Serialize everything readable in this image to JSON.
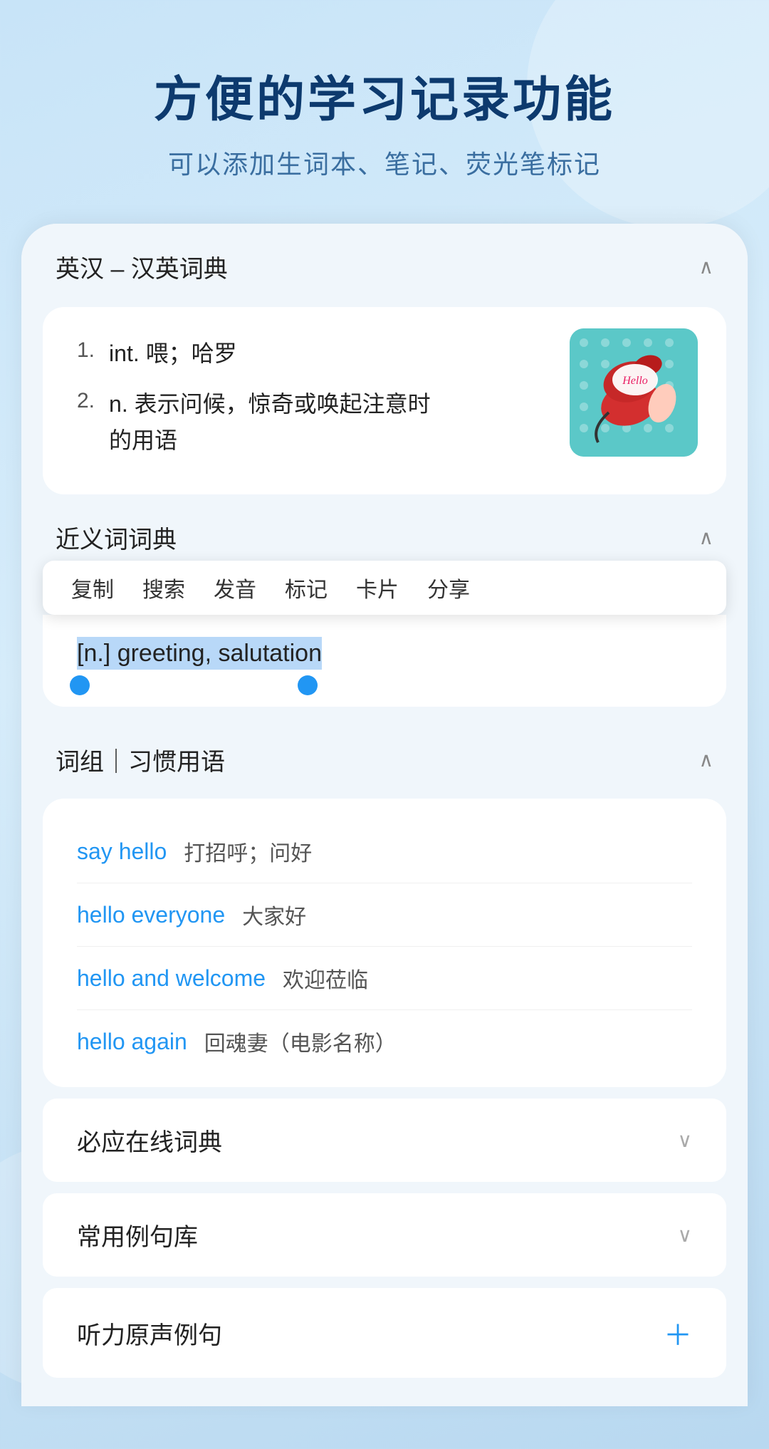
{
  "header": {
    "title": "方便的学习记录功能",
    "subtitle": "可以添加生词本、笔记、荧光笔标记"
  },
  "dictionary_section": {
    "title": "英汉 – 汉英词典",
    "chevron": "∧",
    "definitions": [
      {
        "number": "1.",
        "text": "int. 喂；哈罗"
      },
      {
        "number": "2.",
        "text": "n. 表示问候，惊奇或唤起注意时的用语"
      }
    ]
  },
  "synonyms_section": {
    "title": "近义词词典",
    "chevron": "∧",
    "context_menu": {
      "items": [
        "复制",
        "搜索",
        "发音",
        "标记",
        "卡片",
        "分享"
      ]
    },
    "selected_text": "[n.] greeting, salutation"
  },
  "phrases_section": {
    "title": "词组｜习惯用语",
    "chevron": "∧",
    "phrases": [
      {
        "english": "say hello",
        "chinese": "打招呼；问好"
      },
      {
        "english": "hello everyone",
        "chinese": "大家好"
      },
      {
        "english": "hello and welcome",
        "chinese": "欢迎莅临"
      },
      {
        "english": "hello again",
        "chinese": "回魂妻（电影名称）"
      }
    ]
  },
  "collapsed_sections": [
    {
      "title": "必应在线词典",
      "icon": "chevron-down"
    },
    {
      "title": "常用例句库",
      "icon": "chevron-down"
    },
    {
      "title": "听力原声例句",
      "icon": "plus"
    }
  ]
}
